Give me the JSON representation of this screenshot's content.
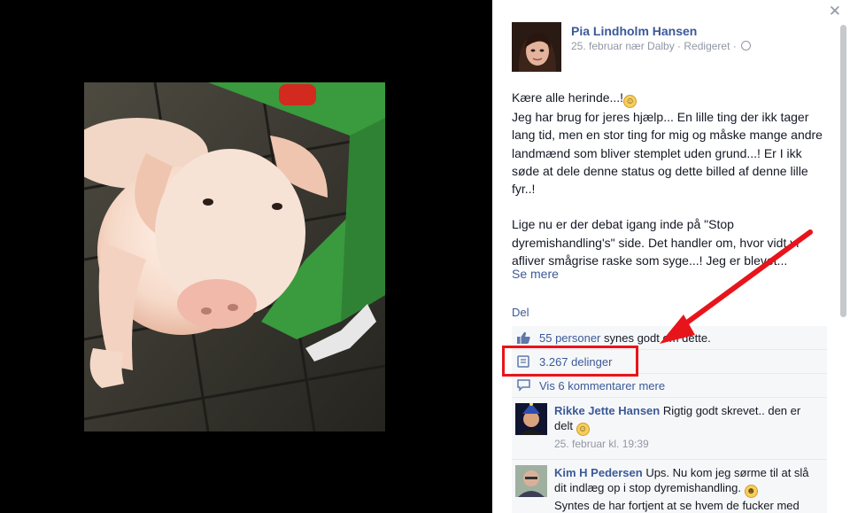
{
  "post": {
    "author": "Pia Lindholm Hansen",
    "meta": "25. februar nær Dalby · Redigeret ·",
    "paragraph1_line1": "Kære alle herinde...!",
    "paragraph1_rest": "Jeg har brug for jeres hjælp... En lille ting der ikk tager lang tid, men en stor ting for mig og måske mange andre landmænd som bliver stemplet uden grund...! Er I ikk søde at dele denne status og dette billed af denne lille fyr..!",
    "paragraph2": "Lige nu er der debat igang inde på \"Stop dyremishandling's\" side. Det handler om, hvor vidt vi afliver smågrise raske som syge...! Jeg er blevet...",
    "see_more": "Se mere"
  },
  "actions": {
    "share": "Del"
  },
  "ufi": {
    "likes_link": "55 personer",
    "likes_suffix": " synes godt om dette.",
    "shares": "3.267 delinger",
    "view_comments": "Vis 6 kommentarer mere"
  },
  "comments": [
    {
      "name": "Rikke Jette Hansen",
      "text": " Rigtig godt skrevet.. den er delt ",
      "time": "25. februar kl. 19:39"
    },
    {
      "name": "Kim H Pedersen",
      "text": " Ups. Nu kom jeg sørme til at slå dit indlæg op i stop dyremishandling. ",
      "text2": "Syntes de har fortjent at se hvem de fucker med"
    }
  ],
  "icons": {
    "close": "close-icon",
    "privacy": "globe-icon",
    "like": "thumbs-up-icon",
    "share": "share-icon",
    "comment": "comment-bubble-icon"
  },
  "colors": {
    "link": "#3b5998",
    "annotation": "#e8141b",
    "ufi_bg": "#f6f7f9"
  }
}
